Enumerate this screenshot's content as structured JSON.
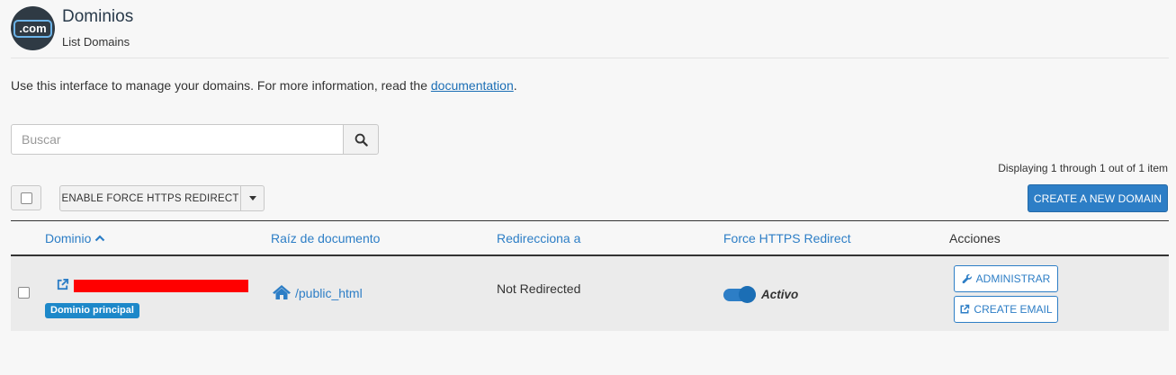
{
  "header": {
    "logo_text": ".com",
    "title": "Dominios",
    "subtitle": "List Domains"
  },
  "intro": {
    "text": "Use this interface to manage your domains. For more information, read the ",
    "link_label": "documentation",
    "suffix": "."
  },
  "search": {
    "placeholder": "Buscar",
    "value": ""
  },
  "pagination": {
    "displaying": "Displaying 1 through 1 out of 1 item"
  },
  "toolbar": {
    "https_button_label": "ENABLE FORCE HTTPS REDIRECT",
    "create_domain_label": "CREATE A NEW DOMAIN"
  },
  "table": {
    "columns": {
      "domain": "Dominio",
      "docroot": "Raíz de documento",
      "redirect": "Redirecciona a",
      "force_https": "Force HTTPS Redirect",
      "actions": "Acciones"
    },
    "rows": [
      {
        "badge": "Dominio principal",
        "docroot": "/public_html",
        "redirect": "Not Redirected",
        "force_https_state": "Activo",
        "manage_label": "ADMINISTRAR",
        "email_label": "CREATE EMAIL"
      }
    ]
  },
  "colors": {
    "accent": "#2d7ec6",
    "redaction": "#ff0000",
    "badge": "#1d88c9"
  }
}
